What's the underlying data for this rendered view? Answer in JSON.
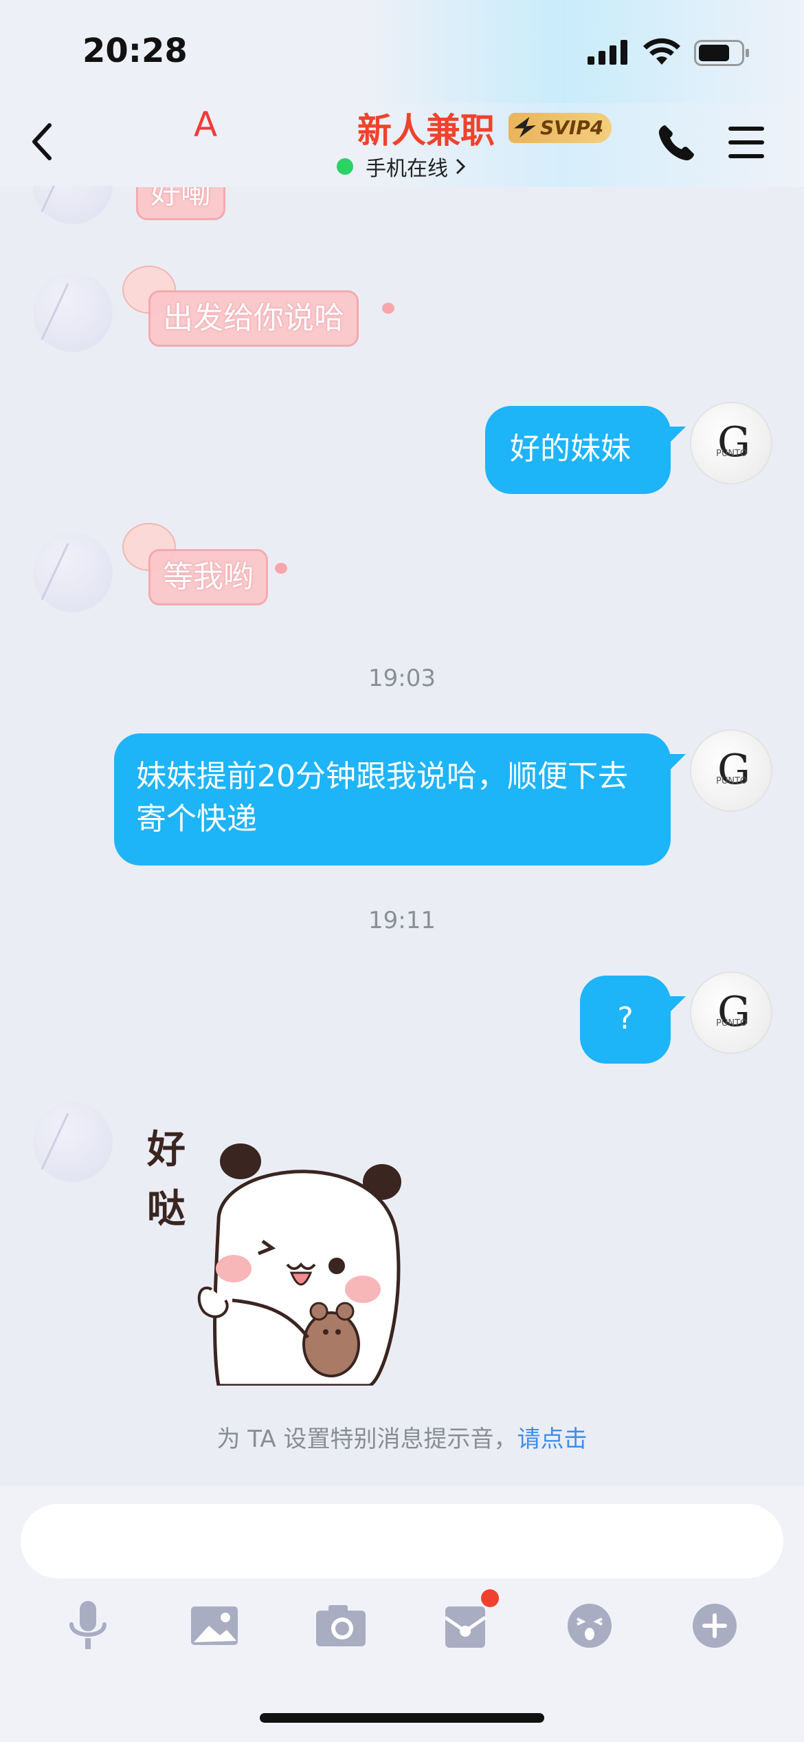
{
  "status_bar": {
    "time": "20:28"
  },
  "header": {
    "left_label": "A",
    "title": "新人兼职",
    "vip_badge": "SVIP4",
    "presence": "手机在线"
  },
  "messages": {
    "top_partial": "好嘞",
    "m1_text": "出发给你说哈",
    "m2_text": "好的妹妹",
    "m3_text": "等我哟",
    "ts1": "19:03",
    "m4_text": "妹妹提前20分钟跟我说哈，顺便下去寄个快递",
    "ts2": "19:11",
    "m5_text": "?",
    "sticker_text": "好哒"
  },
  "avatar": {
    "mark": "G",
    "sub": "PUNTO"
  },
  "notice": {
    "text": "为 TA 设置特别消息提示音，",
    "link": "请点击"
  },
  "input": {
    "placeholder": ""
  },
  "toolbar": {
    "icons": [
      "microphone-icon",
      "image-icon",
      "camera-icon",
      "red-packet-icon",
      "emoji-icon",
      "plus-icon"
    ]
  },
  "colors": {
    "accent_blue": "#1eb4f8",
    "title_red": "#f0422c",
    "online_green": "#2bd264",
    "icon_gray": "#a9adc2"
  }
}
